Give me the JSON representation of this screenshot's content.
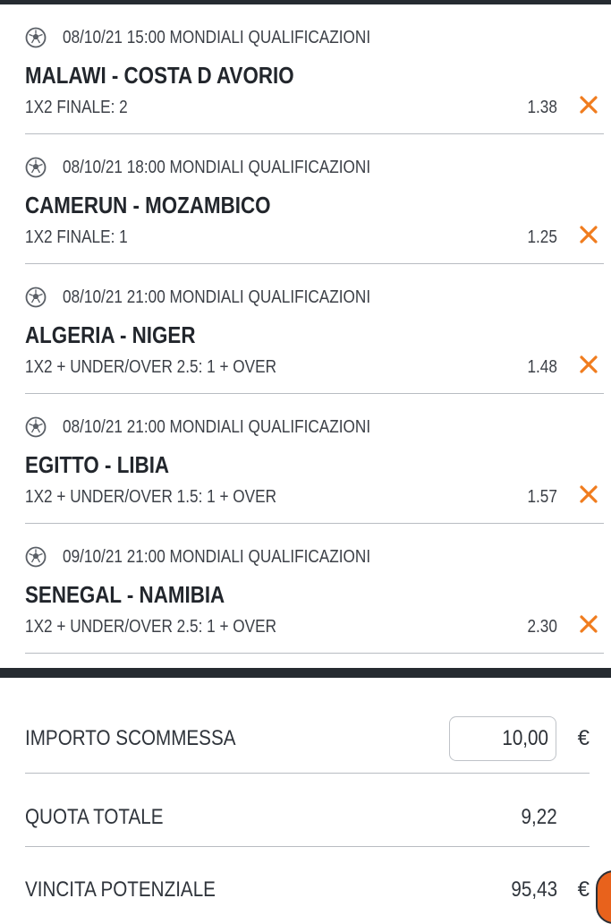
{
  "colors": {
    "accent": "#f07c1e",
    "dark_bar": "#262b31",
    "divider": "#b8bcc2"
  },
  "bets": [
    {
      "meta": "08/10/21 15:00 MONDIALI QUALIFICAZIONI",
      "match": "MALAWI - COSTA D AVORIO",
      "market": "1X2 FINALE: 2",
      "odd": "1.38",
      "icon": "soccer-ball-icon",
      "remove_icon": "close-icon"
    },
    {
      "meta": "08/10/21 18:00 MONDIALI QUALIFICAZIONI",
      "match": "CAMERUN - MOZAMBICO",
      "market": "1X2 FINALE: 1",
      "odd": "1.25",
      "icon": "soccer-ball-icon",
      "remove_icon": "close-icon"
    },
    {
      "meta": "08/10/21 21:00 MONDIALI QUALIFICAZIONI",
      "match": "ALGERIA - NIGER",
      "market": "1X2 + UNDER/OVER 2.5: 1 + OVER",
      "odd": "1.48",
      "icon": "soccer-ball-icon",
      "remove_icon": "close-icon"
    },
    {
      "meta": "08/10/21 21:00 MONDIALI QUALIFICAZIONI",
      "match": "EGITTO - LIBIA",
      "market": "1X2 + UNDER/OVER 1.5: 1 + OVER",
      "odd": "1.57",
      "icon": "soccer-ball-icon",
      "remove_icon": "close-icon"
    },
    {
      "meta": "09/10/21 21:00 MONDIALI QUALIFICAZIONI",
      "match": "SENEGAL - NAMIBIA",
      "market": "1X2 + UNDER/OVER 2.5: 1 + OVER",
      "odd": "2.30",
      "icon": "soccer-ball-icon",
      "remove_icon": "close-icon"
    }
  ],
  "summary": {
    "stake_label": "IMPORTO SCOMMESSA",
    "stake_value": "10,00",
    "currency": "€",
    "total_odds_label": "QUOTA TOTALE",
    "total_odds_value": "9,22",
    "potential_win_label": "VINCITA POTENZIALE",
    "potential_win_value": "95,43"
  }
}
